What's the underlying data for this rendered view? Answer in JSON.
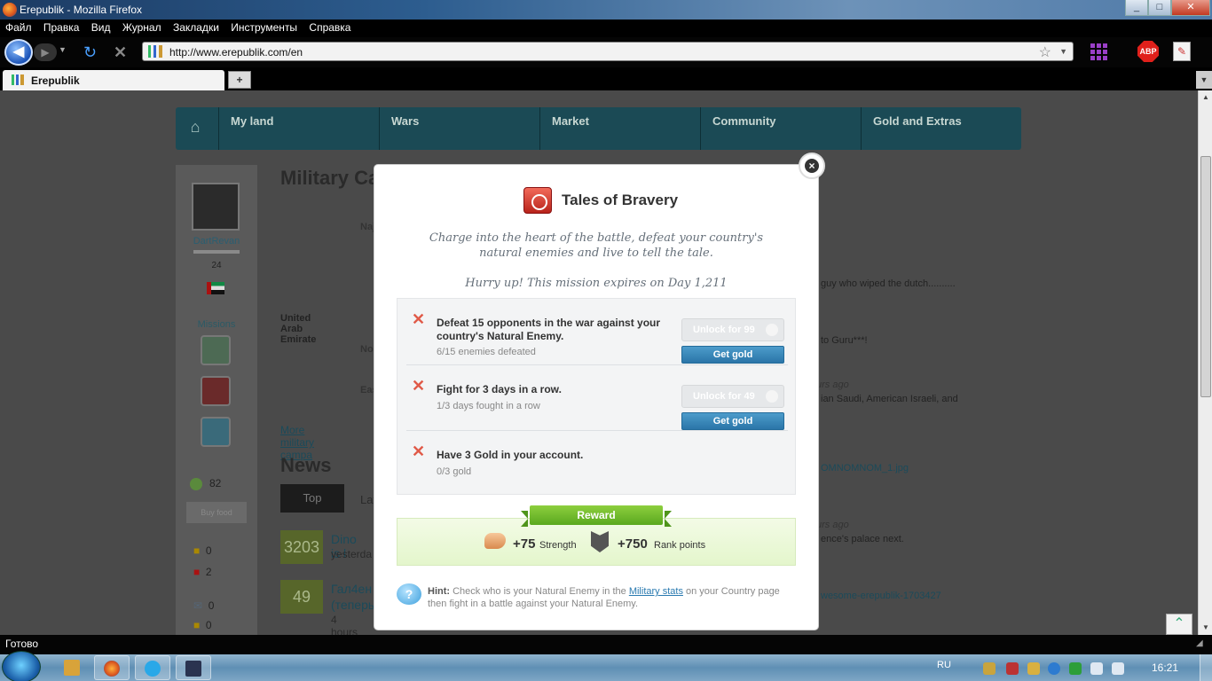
{
  "window": {
    "title": "Erepublik - Mozilla Firefox",
    "controls": [
      "_",
      "□",
      "✕"
    ]
  },
  "menu": [
    "Файл",
    "Правка",
    "Вид",
    "Журнал",
    "Закладки",
    "Инструменты",
    "Справка"
  ],
  "nav": {
    "back_icon": "arrow-left-icon",
    "forward_icon": "arrow-right-icon",
    "reload_icon": "reload-icon",
    "stop_icon": "stop-icon",
    "url": "http://www.erepublik.com/en",
    "abp_label": "ABP"
  },
  "tab": {
    "label": "Erepublik",
    "new_tab": "+"
  },
  "site": {
    "topnav": [
      "My land",
      "Wars",
      "Market",
      "Community",
      "Gold and Extras"
    ],
    "user": {
      "name": "DartRevan",
      "level": "24"
    },
    "missions_label": "Missions",
    "gold": "82",
    "buy_food": "Buy food",
    "stats": [
      "0",
      "2",
      "0",
      "0"
    ],
    "military_heading": "Military Ca",
    "uae_label": "United Arab Emirate",
    "battle_rows": [
      "Naj",
      "Nor",
      "Eas"
    ],
    "military_link": "More military campa",
    "news_heading": "News",
    "news_tabs": [
      "Top",
      "Lat"
    ],
    "news": [
      {
        "score": "3203",
        "title": "Dino is l",
        "sub": "yesterda"
      },
      {
        "score": "49",
        "title": "Гал4ен",
        "sub": "(теперь",
        "time": "4 hours a"
      }
    ],
    "right_snippets": [
      "guy who wiped the dutch..........",
      "to Guru***!",
      "urs ago",
      "ian Saudi, American Israeli, and",
      "OMNOMNOM_1.jpg",
      "urs ago",
      "ence's palace next.",
      "wesome-erepublik-1703427"
    ]
  },
  "modal": {
    "title": "Tales of Bravery",
    "description": "Charge into the heart of the battle, defeat your country's natural enemies and live to tell the tale.",
    "expires": "Hurry up! This mission expires on Day 1,211",
    "close_label": "×",
    "tasks": [
      {
        "title": "Defeat 15 opponents in the war against your country's Natural Enemy.",
        "progress": "6/15 enemies defeated",
        "unlock": "Unlock for 99",
        "get_gold": "Get gold"
      },
      {
        "title": "Fight for 3 days in a row.",
        "progress": "1/3 days fought in a row",
        "unlock": "Unlock for 49",
        "get_gold": "Get gold"
      },
      {
        "title": "Have 3 Gold in your account.",
        "progress": "0/3 gold"
      }
    ],
    "reward": {
      "label": "Reward",
      "strength_value": "+75",
      "strength_label": "Strength",
      "rank_value": "+750",
      "rank_label": "Rank points"
    },
    "hint": {
      "label": "Hint:",
      "text_before": "Check who is your Natural Enemy in the",
      "link": "Military stats",
      "text_after": "on your Country page then fight in a battle against your Natural Enemy."
    }
  },
  "status": "Готово",
  "taskbar": {
    "lang": "RU",
    "clock": "16:21"
  }
}
